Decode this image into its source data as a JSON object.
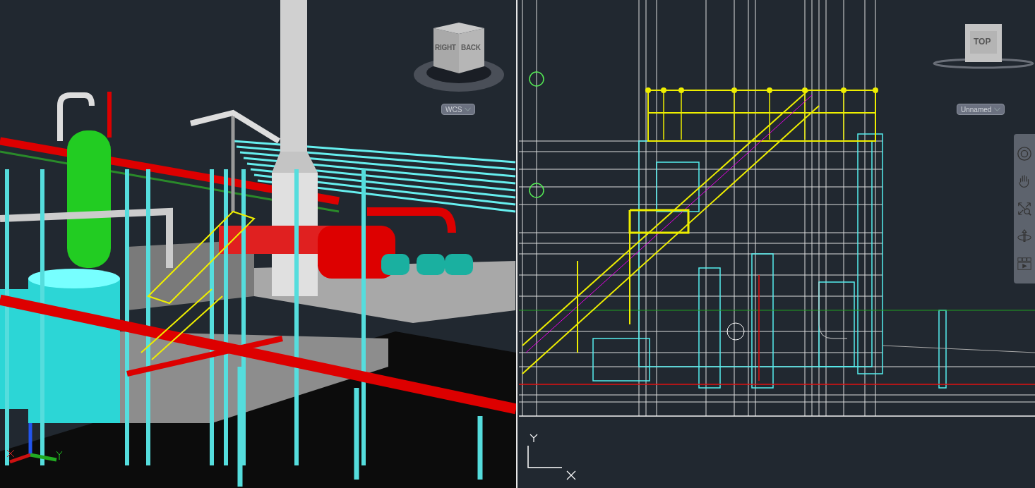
{
  "viewports": [
    {
      "kind": "model3d",
      "viewcube": {
        "faces": [
          "RIGHT",
          "BACK"
        ]
      },
      "coordinate_system": "WCS"
    },
    {
      "kind": "wireframe2d",
      "viewcube": {
        "faces": [
          "TOP"
        ]
      },
      "coordinate_system": "Unnamed"
    }
  ]
}
